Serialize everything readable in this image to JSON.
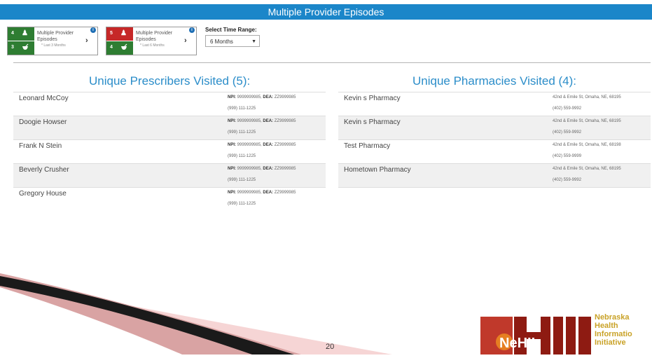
{
  "header": {
    "title": "Multiple Provider Episodes"
  },
  "cards": [
    {
      "top_count": "4",
      "bottom_count": "3",
      "title": "Multiple Provider Episodes",
      "subtitle": "* Last 3 Months",
      "color": "#2e7d32"
    },
    {
      "top_count": "5",
      "bottom_count": "4",
      "title": "Multiple Provider Episodes",
      "subtitle": "* Last 6 Months",
      "color": "#c62828"
    }
  ],
  "time_range": {
    "label": "Select Time Range:",
    "value": "6 Months"
  },
  "prescribers": {
    "title": "Unique Prescribers Visited (5):",
    "rows": [
      {
        "name": "Leonard McCoy",
        "npi_label": "NPI:",
        "npi": "9999999985,",
        "dea_label": "DEA:",
        "dea": "ZZ9999985",
        "phone": "(999) 111-1225"
      },
      {
        "name": "Doogie Howser",
        "npi_label": "NPI:",
        "npi": "9999999985,",
        "dea_label": "DEA:",
        "dea": "ZZ9999985",
        "phone": "(999) 111-1225"
      },
      {
        "name": "Frank N Stein",
        "npi_label": "NPI:",
        "npi": "9999999985,",
        "dea_label": "DEA:",
        "dea": "ZZ9999985",
        "phone": "(999) 111-1225"
      },
      {
        "name": "Beverly Crusher",
        "npi_label": "NPI:",
        "npi": "9999999985,",
        "dea_label": "DEA:",
        "dea": "ZZ9999985",
        "phone": "(999) 111-1225"
      },
      {
        "name": "Gregory House",
        "npi_label": "NPI:",
        "npi": "9999999985,",
        "dea_label": "DEA:",
        "dea": "ZZ9999985",
        "phone": "(999) 111-1225"
      }
    ]
  },
  "pharmacies": {
    "title": "Unique Pharmacies Visited (4):",
    "rows": [
      {
        "name": "Kevin s Pharmacy",
        "address": "42nd & Emile St, Omaha, NE, 68195",
        "phone": "(402) 559-9992"
      },
      {
        "name": "Kevin s Pharmacy",
        "address": "42nd & Emile St, Omaha, NE, 68195",
        "phone": "(402) 559-9992"
      },
      {
        "name": "Test Pharmacy",
        "address": "42nd & Emile St, Omaha, NE, 68198",
        "phone": "(402) 559-9999"
      },
      {
        "name": "Hometown Pharmacy",
        "address": "42nd & Emile St, Omaha, NE, 68195",
        "phone": "(402) 559-9992"
      }
    ]
  },
  "footer": {
    "page_number": "20",
    "logo_letters": "NeHII",
    "logo_lines": [
      "Nebraska",
      "Health",
      "Informatio",
      "Initiative"
    ]
  },
  "icons": {
    "prescriber": "user-icon",
    "pharmacy": "mortar-pestle-icon",
    "info": "info-icon",
    "chevron": "chevron-right-icon"
  }
}
